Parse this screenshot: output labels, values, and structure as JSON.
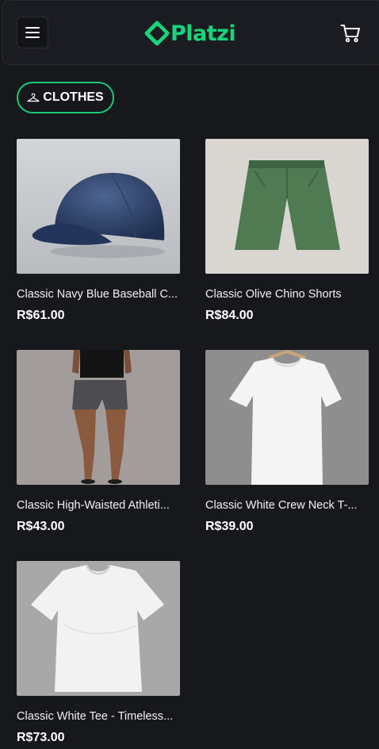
{
  "header": {
    "menu_icon": "hamburger-menu-icon",
    "logo_text": "Platzi",
    "logo_icon": "platzi-logo-icon",
    "cart_icon": "cart-icon",
    "brand_color": "#17d57c"
  },
  "category": {
    "label": "CLOTHES",
    "icon": "hanger-icon"
  },
  "products": [
    {
      "title": "Classic Navy Blue Baseball Cap",
      "display_title": "Classic Navy Blue Baseball C...",
      "price": "R$61.00"
    },
    {
      "title": "Classic Olive Chino Shorts",
      "display_title": "Classic Olive Chino Shorts",
      "price": "R$84.00"
    },
    {
      "title": "Classic High-Waisted Athletic",
      "display_title": "Classic High-Waisted Athleti...",
      "price": "R$43.00"
    },
    {
      "title": "Classic White Crew Neck T-",
      "display_title": "Classic White Crew Neck T-...",
      "price": "R$39.00"
    },
    {
      "title": "Classic White Tee - Timeless",
      "display_title": "Classic White Tee - Timeless...",
      "price": "R$73.00"
    }
  ]
}
